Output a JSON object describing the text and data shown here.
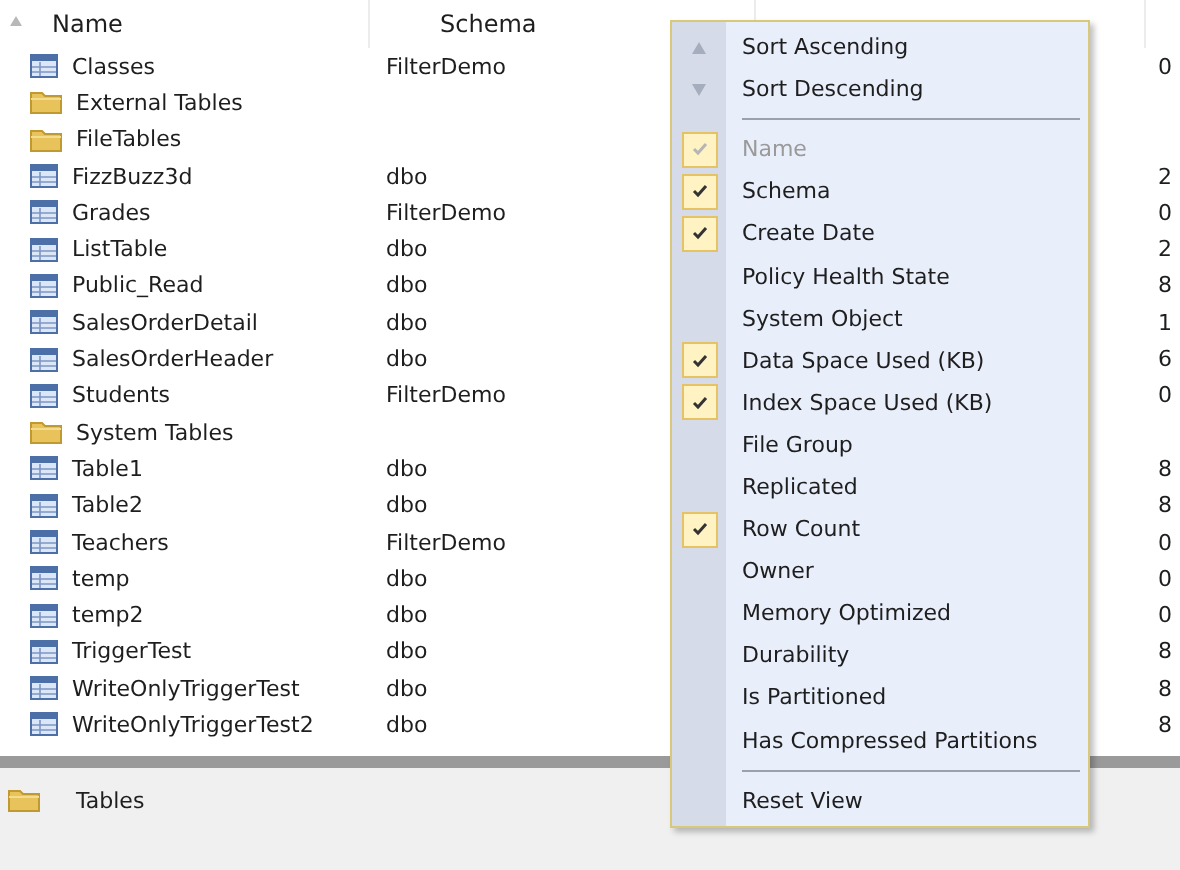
{
  "table": {
    "columns": [
      {
        "label": "Name",
        "sorted": true
      },
      {
        "label": "Schema",
        "sorted": false
      }
    ],
    "rows": [
      {
        "kind": "table",
        "name": "Classes",
        "schema": "FilterDemo",
        "column_4": "0"
      },
      {
        "kind": "folder",
        "name": "External Tables",
        "schema": "",
        "column_4": ""
      },
      {
        "kind": "folder",
        "name": "FileTables",
        "schema": "",
        "column_4": ""
      },
      {
        "kind": "table",
        "name": "FizzBuzz3d",
        "schema": "dbo",
        "column_4": "2"
      },
      {
        "kind": "table",
        "name": "Grades",
        "schema": "FilterDemo",
        "column_4": "0"
      },
      {
        "kind": "table",
        "name": "ListTable",
        "schema": "dbo",
        "column_4": "2"
      },
      {
        "kind": "table",
        "name": "Public_Read",
        "schema": "dbo",
        "column_4": "8"
      },
      {
        "kind": "table",
        "name": "SalesOrderDetail",
        "schema": "dbo",
        "column_4": "1"
      },
      {
        "kind": "table",
        "name": "SalesOrderHeader",
        "schema": "dbo",
        "column_4": "6"
      },
      {
        "kind": "table",
        "name": "Students",
        "schema": "FilterDemo",
        "column_4": "0"
      },
      {
        "kind": "folder",
        "name": "System Tables",
        "schema": "",
        "column_4": ""
      },
      {
        "kind": "table",
        "name": "Table1",
        "schema": "dbo",
        "column_4": "8"
      },
      {
        "kind": "table",
        "name": "Table2",
        "schema": "dbo",
        "column_4": "8"
      },
      {
        "kind": "table",
        "name": "Teachers",
        "schema": "FilterDemo",
        "column_4": "0"
      },
      {
        "kind": "table",
        "name": "temp",
        "schema": "dbo",
        "column_4": "0"
      },
      {
        "kind": "table",
        "name": "temp2",
        "schema": "dbo",
        "column_4": "0"
      },
      {
        "kind": "table",
        "name": "TriggerTest",
        "schema": "dbo",
        "column_4": "8"
      },
      {
        "kind": "table",
        "name": "WriteOnlyTriggerTest",
        "schema": "dbo",
        "column_4": "8"
      },
      {
        "kind": "table",
        "name": "WriteOnlyTriggerTest2",
        "schema": "dbo",
        "column_4": "8"
      }
    ]
  },
  "context_menu": {
    "items": [
      {
        "kind": "sort-ascending",
        "label": "Sort Ascending"
      },
      {
        "kind": "sort-descending",
        "label": "Sort Descending"
      },
      {
        "kind": "separator"
      },
      {
        "kind": "check",
        "label": "Name",
        "checked": true,
        "disabled": true
      },
      {
        "kind": "check",
        "label": "Schema",
        "checked": true,
        "disabled": false
      },
      {
        "kind": "check",
        "label": "Create Date",
        "checked": true,
        "disabled": false
      },
      {
        "kind": "check",
        "label": "Policy Health State",
        "checked": false,
        "disabled": false
      },
      {
        "kind": "check",
        "label": "System Object",
        "checked": false,
        "disabled": false
      },
      {
        "kind": "check",
        "label": "Data Space Used (KB)",
        "checked": true,
        "disabled": false
      },
      {
        "kind": "check",
        "label": "Index Space Used (KB)",
        "checked": true,
        "disabled": false
      },
      {
        "kind": "check",
        "label": "File Group",
        "checked": false,
        "disabled": false
      },
      {
        "kind": "check",
        "label": "Replicated",
        "checked": false,
        "disabled": false
      },
      {
        "kind": "check",
        "label": "Row Count",
        "checked": true,
        "disabled": false
      },
      {
        "kind": "check",
        "label": "Owner",
        "checked": false,
        "disabled": false
      },
      {
        "kind": "check",
        "label": "Memory Optimized",
        "checked": false,
        "disabled": false
      },
      {
        "kind": "check",
        "label": "Durability",
        "checked": false,
        "disabled": false
      },
      {
        "kind": "check",
        "label": "Is Partitioned",
        "checked": false,
        "disabled": false
      },
      {
        "kind": "check",
        "label": "Has Compressed Partitions",
        "checked": false,
        "disabled": false
      },
      {
        "kind": "separator"
      },
      {
        "kind": "action",
        "label": "Reset View"
      }
    ]
  },
  "status_bar": {
    "kind": "folder",
    "label": "Tables"
  }
}
